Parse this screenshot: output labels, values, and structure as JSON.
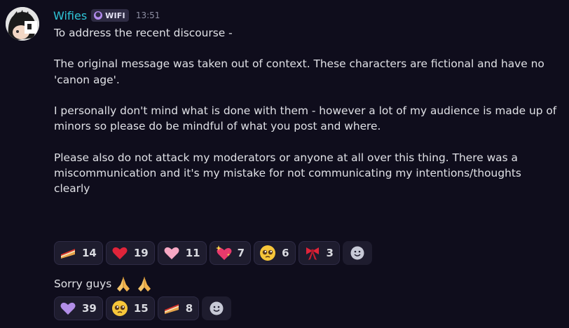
{
  "author": {
    "name": "Wifies",
    "tag": "WIFI",
    "timestamp": "13:51"
  },
  "message": {
    "paragraphs": [
      "To address the recent discourse -",
      "The original message was taken out of context. These characters are fictional and have no 'canon age'.",
      "I personally don't mind what is done with them - however a lot of my audience is made up of minors so please do be mindful of what you post and where.",
      "Please also do not attack my moderators or anyone at all over this thing. There was a miscommunication and it's my mistake for not communicating my intentions/thoughts clearly"
    ],
    "reactions": [
      {
        "icon": "cake-slice-icon",
        "count": "14"
      },
      {
        "icon": "red-heart-icon",
        "count": "19"
      },
      {
        "icon": "pink-heart-icon",
        "count": "11"
      },
      {
        "icon": "sparkling-heart-icon",
        "count": "7"
      },
      {
        "icon": "pleading-face-icon",
        "count": "6"
      },
      {
        "icon": "ribbon-icon",
        "count": "3"
      }
    ]
  },
  "followup": {
    "text": "Sorry guys",
    "emoji": [
      "folded-hands-icon",
      "folded-hands-icon"
    ],
    "reactions": [
      {
        "icon": "purple-heart-icon",
        "count": "39"
      },
      {
        "icon": "pleading-face-icon",
        "count": "15"
      },
      {
        "icon": "cake-slice-icon",
        "count": "8"
      }
    ]
  },
  "colors": {
    "background": "#0f0d1c",
    "username": "#2fc6d8",
    "reaction_bg": "#1e1c2e"
  }
}
